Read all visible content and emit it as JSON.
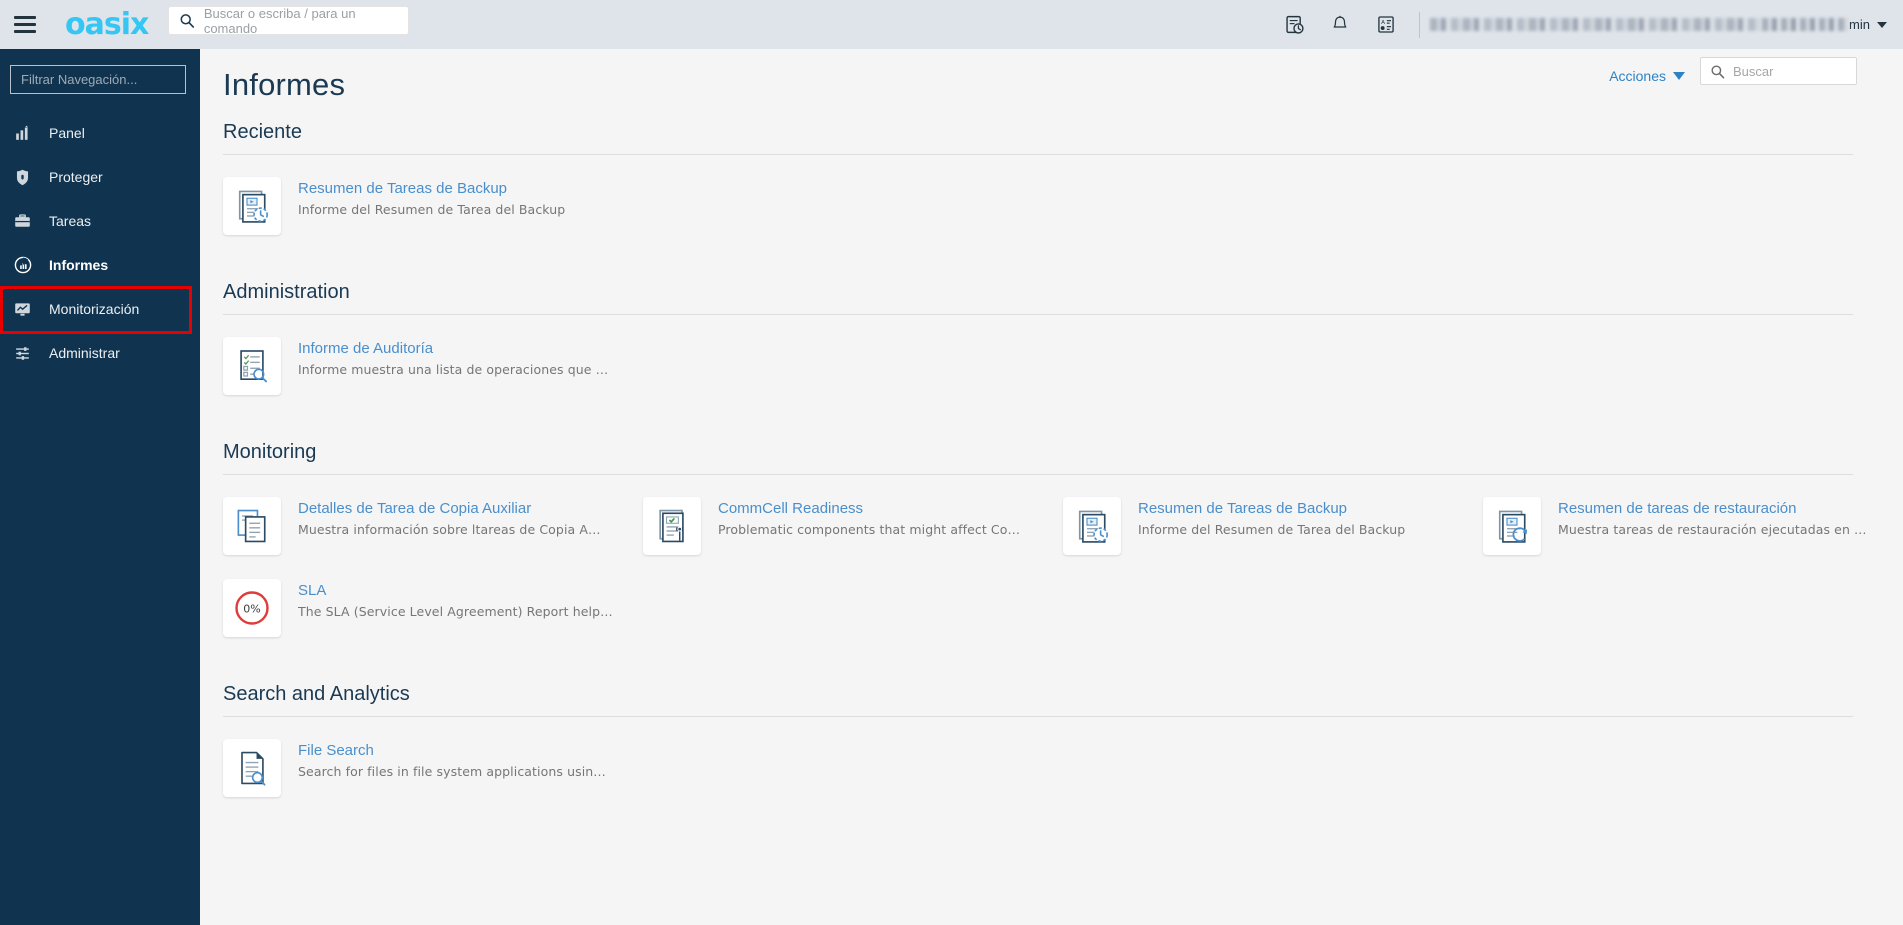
{
  "header": {
    "menu_icon": "hamburger-icon",
    "brand": "oasix",
    "search_placeholder": "Buscar o escriba / para un comando",
    "icons": [
      {
        "name": "scheduler-icon",
        "label": "Programador"
      },
      {
        "name": "bell-icon",
        "label": "Notificaciones"
      },
      {
        "name": "tasks-list-icon",
        "label": "Tareas"
      }
    ],
    "user_tail": "min"
  },
  "sidebar": {
    "filter_placeholder": "Filtrar Navegación...",
    "items": [
      {
        "label": "Panel",
        "icon": "dashboard-icon",
        "active": false
      },
      {
        "label": "Proteger",
        "icon": "shield-icon",
        "active": false
      },
      {
        "label": "Tareas",
        "icon": "briefcase-icon",
        "active": false
      },
      {
        "label": "Informes",
        "icon": "report-chart-icon",
        "active": true
      },
      {
        "label": "Monitorización",
        "icon": "monitor-chart-icon",
        "active": false
      },
      {
        "label": "Administrar",
        "icon": "sliders-icon",
        "active": false
      }
    ]
  },
  "page": {
    "title": "Informes",
    "actions_label": "Acciones",
    "search_placeholder": "Buscar"
  },
  "sections": [
    {
      "title": "Reciente",
      "cards": [
        {
          "title": "Resumen de Tareas de Backup",
          "desc": "Informe del Resumen de Tarea del Backup",
          "icon": "doc-clock-icon"
        }
      ]
    },
    {
      "title": "Administration",
      "cards": [
        {
          "title": "Informe de Auditoría",
          "desc": "Informe muestra una lista de operaciones que …",
          "icon": "doc-checklist-search-icon"
        }
      ]
    },
    {
      "title": "Monitoring",
      "cards": [
        {
          "title": "Detalles de Tarea de Copia Auxiliar",
          "desc": "Muestra información sobre ltareas de Copia A…",
          "icon": "doc-copy-icon"
        },
        {
          "title": "CommCell Readiness",
          "desc": "Problematic components that might affect Co…",
          "icon": "doc-check-signal-icon"
        },
        {
          "title": "Resumen de Tareas de Backup",
          "desc": "Informe del Resumen de Tarea del Backup",
          "icon": "doc-clock-icon"
        },
        {
          "title": "Resumen de tareas de restauración",
          "desc": "Muestra tareas de restauración ejecutadas en …",
          "icon": "doc-restore-icon"
        },
        {
          "title": "SLA",
          "desc": "The SLA (Service Level Agreement) Report help…",
          "icon": "sla-percent-icon",
          "icon_value": "0%"
        }
      ]
    },
    {
      "title": "Search and Analytics",
      "cards": [
        {
          "title": "File Search",
          "desc": "Search for files in file system applications usin…",
          "icon": "doc-search-icon"
        }
      ]
    }
  ],
  "colors": {
    "brand": "#35c6f4",
    "sidebar_bg": "#10344f",
    "header_bg": "#dfe4ea",
    "link": "#4a8fcc",
    "accent_red": "#e60000",
    "sla_red": "#e03b3b",
    "content_bg": "#f5f5f6"
  }
}
